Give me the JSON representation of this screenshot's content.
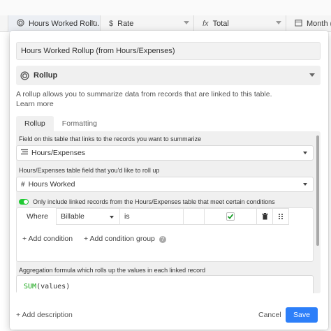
{
  "grid_columns": [
    {
      "icon": "rollup-icon",
      "label": "Hours Worked Rollu..."
    },
    {
      "icon": "currency-icon",
      "glyph": "$",
      "label": "Rate"
    },
    {
      "icon": "formula-icon",
      "glyph": "fx",
      "label": "Total"
    },
    {
      "icon": "calendar-icon",
      "label": "Month (fr"
    }
  ],
  "dialog": {
    "field_name": "Hours Worked Rollup (from Hours/Expenses)",
    "field_type": "Rollup",
    "description_line": "A rollup allows you to summarize data from records that are linked to this table.",
    "learn_more": "Learn more",
    "tabs": [
      "Rollup",
      "Formatting"
    ],
    "link_label": "Field on this table that links to the records you want to summarize",
    "link_value": "Hours/Expenses",
    "rollup_label": "Hours/Expenses table field that you'd like to roll up",
    "rollup_value": "Hours Worked",
    "toggle_label": "Only include linked records from the Hours/Expenses table that meet certain conditions",
    "toggle_on": true,
    "condition": {
      "where": "Where",
      "field": "Billable",
      "operator": "is",
      "value_checked": true
    },
    "add_condition": "+ Add condition",
    "add_condition_group": "+ Add condition group",
    "aggregation_label": "Aggregation formula which rolls up the values in each linked record",
    "formula_fn": "SUM",
    "formula_args": "(values)",
    "add_description": "+ Add description",
    "cancel": "Cancel",
    "save": "Save"
  },
  "colors": {
    "accent": "#2d7ff9",
    "toggle_on": "#20c933",
    "formula_fn": "#14a514"
  }
}
